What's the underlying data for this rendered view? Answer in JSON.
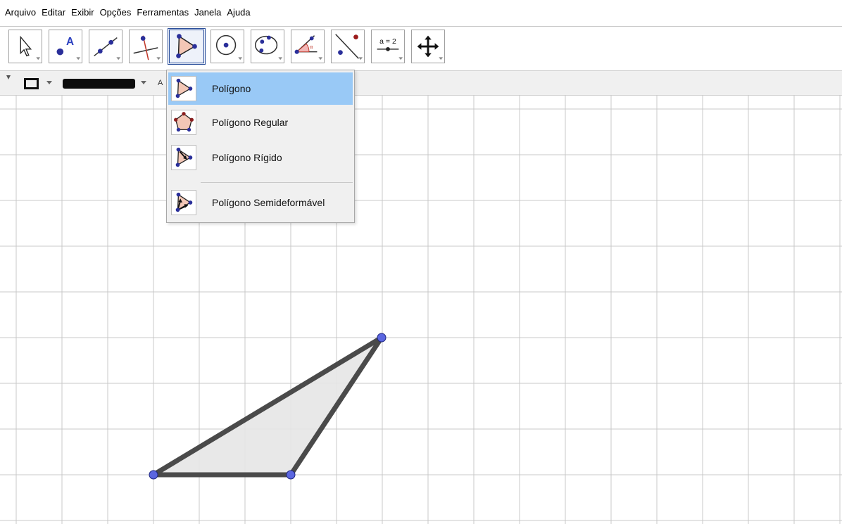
{
  "menubar": {
    "items": [
      "Arquivo",
      "Editar",
      "Exibir",
      "Opções",
      "Ferramentas",
      "Janela",
      "Ajuda"
    ]
  },
  "toolbar": {
    "tools": [
      {
        "name": "move-tool",
        "icon": "arrow-pointer-icon"
      },
      {
        "name": "point-tool",
        "icon": "point-icon"
      },
      {
        "name": "line-tool",
        "icon": "line-icon"
      },
      {
        "name": "perpendicular-tool",
        "icon": "perpendicular-line-icon"
      },
      {
        "name": "polygon-tool",
        "icon": "polygon-icon",
        "active": true
      },
      {
        "name": "circle-tool",
        "icon": "circle-center-point-icon"
      },
      {
        "name": "conic-tool",
        "icon": "ellipse-icon"
      },
      {
        "name": "angle-tool",
        "icon": "angle-icon",
        "label": "α"
      },
      {
        "name": "reflect-tool",
        "icon": "reflect-icon"
      },
      {
        "name": "slider-tool",
        "icon": "slider-icon",
        "label": "a = 2"
      },
      {
        "name": "move-view-tool",
        "icon": "move-graphics-view-icon"
      }
    ]
  },
  "stylebar": {
    "label_button": "A"
  },
  "dropdown": {
    "items": [
      {
        "label": "Polígono",
        "icon": "polygon-icon",
        "selected": true
      },
      {
        "label": "Polígono Regular",
        "icon": "regular-polygon-icon",
        "selected": false
      },
      {
        "label": "Polígono Rígido",
        "icon": "rigid-polygon-icon",
        "selected": false
      },
      {
        "label": "Polígono Semideformável",
        "icon": "vector-polygon-icon",
        "selected": false
      }
    ]
  },
  "colors": {
    "accent_selected": "#99c9f6",
    "point_fill": "#5b66e0",
    "polygon_stroke": "#4a4a4a",
    "polygon_fill": "#e6e6e6",
    "grid": "#c8c8c8"
  }
}
